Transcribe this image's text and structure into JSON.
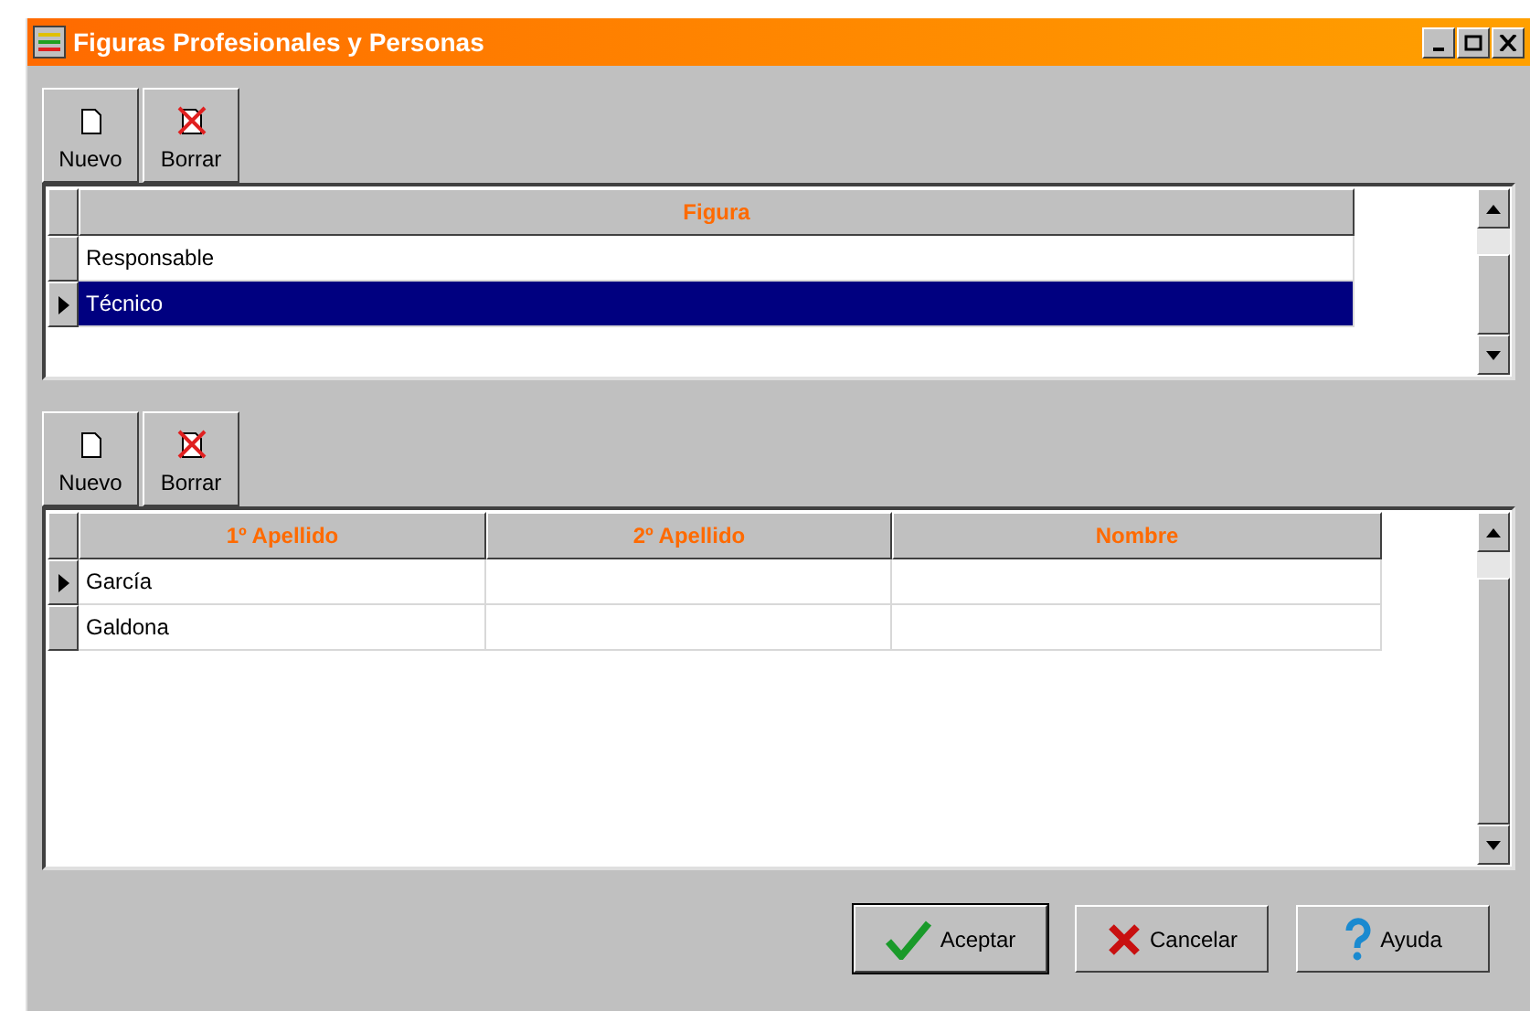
{
  "window": {
    "title": "Figuras Profesionales y Personas"
  },
  "sections": [
    {
      "toolbar": [
        {
          "kind": "new",
          "label": "Nuevo"
        },
        {
          "kind": "delete",
          "label": "Borrar"
        }
      ],
      "table": {
        "columns": [
          "Figura"
        ],
        "rows": [
          {
            "cells": [
              "Responsable"
            ],
            "selected": false,
            "current": false
          },
          {
            "cells": [
              "Técnico"
            ],
            "selected": true,
            "current": true
          }
        ]
      }
    },
    {
      "toolbar": [
        {
          "kind": "new",
          "label": "Nuevo"
        },
        {
          "kind": "delete",
          "label": "Borrar"
        }
      ],
      "table": {
        "columns": [
          "1º Apellido",
          "2º Apellido",
          "Nombre"
        ],
        "rows": [
          {
            "cells": [
              "García",
              "",
              ""
            ],
            "selected": false,
            "current": true
          },
          {
            "cells": [
              "Galdona",
              "",
              ""
            ],
            "selected": false,
            "current": false
          }
        ]
      }
    }
  ],
  "buttons": [
    {
      "kind": "accept",
      "label": "Aceptar",
      "default": true
    },
    {
      "kind": "cancel",
      "label": "Cancelar",
      "default": false
    },
    {
      "kind": "help",
      "label": "Ayuda",
      "default": false
    }
  ]
}
